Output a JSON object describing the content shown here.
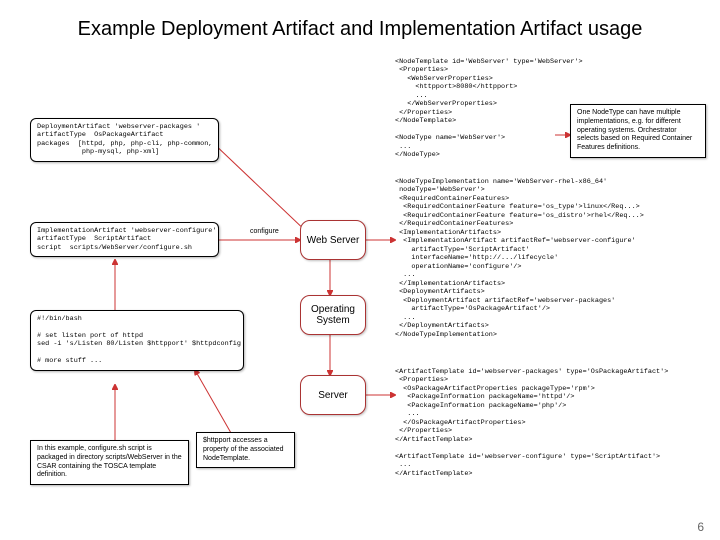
{
  "title": "Example Deployment Artifact and Implementation Artifact usage",
  "deployBox": "DeploymentArtifact 'webserver-packages '\nartifactType  OsPackageArtifact\npackages  [httpd, php, php-cli, php-common,\n           php-mysql, php-xml]",
  "implBox": "ImplementationArtifact 'webserver-configure'\nartifactType  ScriptArtifact\nscript  scripts/WebServer/configure.sh",
  "scriptBox": "#!/bin/bash\n\n# set listen port of httpd\nsed -i 's/Listen 80/Listen $httpport' $httpdconfig\n\n# more stuff ...",
  "noteExample": "In this example, configure.sh script is packaged in directory scripts/WebServer in the CSAR containing the TOSCA template definition.",
  "noteHttpport": "$httpport accesses a property of the associated NodeTemplate.",
  "noteNodeType": "One NodeType can have multiple implementations, e.g. for different operating systems. Orchestrator selects based on Required Container Features definitions.",
  "nodes": {
    "web": "Web\nServer",
    "os": "Operating\nSystem",
    "server": "Server"
  },
  "configure": "configure",
  "code1": "<NodeTemplate id='WebServer' type='WebServer'>\n <Properties>\n   <WebServerProperties>\n     <httpport>8080</httpport>\n     ...\n   </WebServerProperties>\n </Properties>\n</NodeTemplate>\n\n<NodeType name='WebServer'>\n ...\n</NodeType>",
  "code2": "<NodeTypeImplementation name='WebServer-rhel-x86_64'\n nodeType='WebServer'>\n <RequiredContainerFeatures>\n  <RequiredContainerFeature feature='os_type'>linux</Req...>\n  <RequiredContainerFeature feature='os_distro'>rhel</Req...>\n </RequiredContainerFeatures>\n <ImplementationArtifacts>\n  <ImplementationArtifact artifactRef='webserver-configure'\n    artifactType='ScriptArtifact'\n    interfaceName='http://.../lifecycle'\n    operationName='configure'/>\n  ...\n </ImplementationArtifacts>\n <DeploymentArtifacts>\n  <DeploymentArtifact artifactRef='webserver-packages'\n    artifactType='OsPackageArtifact'/>\n  ...\n </DeploymentArtifacts>\n</NodeTypeImplementation>",
  "code3": "<ArtifactTemplate id='webserver-packages' type='OsPackageArtifact'>\n <Properties>\n  <OsPackageArtifactProperties packageType='rpm'>\n   <PackageInformation packageName='httpd'/>\n   <PackageInformation packageName='php'/>\n   ...\n  </OsPackageArtifactProperties>\n </Properties>\n</ArtifactTemplate>\n\n<ArtifactTemplate id='webserver-configure' type='ScriptArtifact'>\n ...\n</ArtifactTemplate>",
  "pagenum": "6"
}
